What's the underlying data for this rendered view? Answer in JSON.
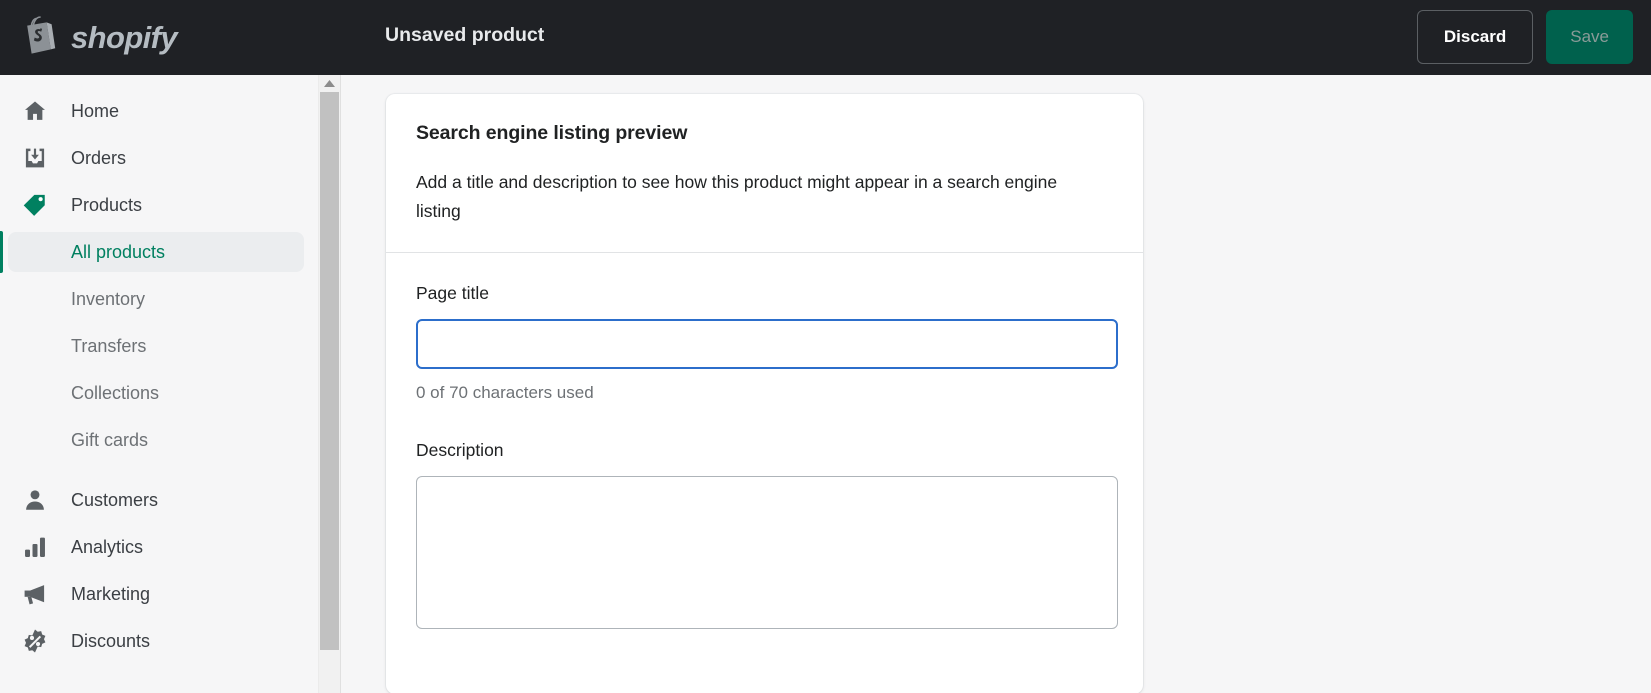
{
  "topbar": {
    "logo_icon": "shopify-bag-icon",
    "logo_word": "shopify",
    "title": "Unsaved product",
    "discard_label": "Discard",
    "save_label": "Save",
    "background": "#1f2125",
    "save_background": "#00614d"
  },
  "sidebar": {
    "items": [
      {
        "label": "Home",
        "icon": "home-icon",
        "type": "nav"
      },
      {
        "label": "Orders",
        "icon": "inbox-download-icon",
        "type": "nav"
      },
      {
        "label": "Products",
        "icon": "tag-icon",
        "type": "nav",
        "icon_color": "#008060"
      },
      {
        "label": "All products",
        "icon": "",
        "type": "sub",
        "active": true
      },
      {
        "label": "Inventory",
        "icon": "",
        "type": "sub"
      },
      {
        "label": "Transfers",
        "icon": "",
        "type": "sub"
      },
      {
        "label": "Collections",
        "icon": "",
        "type": "sub"
      },
      {
        "label": "Gift cards",
        "icon": "",
        "type": "sub"
      },
      {
        "label": "Customers",
        "icon": "person-icon",
        "type": "nav"
      },
      {
        "label": "Analytics",
        "icon": "bar-chart-icon",
        "type": "nav"
      },
      {
        "label": "Marketing",
        "icon": "megaphone-icon",
        "type": "nav"
      },
      {
        "label": "Discounts",
        "icon": "percent-badge-icon",
        "type": "nav"
      }
    ],
    "active_color": "#008060",
    "scrollbar": {
      "up_arrow_icon": "caret-up-icon"
    }
  },
  "main": {
    "card": {
      "title": "Search engine listing preview",
      "subtitle": "Add a title and description to see how this product might appear in a search engine listing",
      "page_title": {
        "label": "Page title",
        "value": "",
        "placeholder": "",
        "help": "0 of 70 characters used",
        "focused": true,
        "focus_color": "#2c6ecb"
      },
      "description": {
        "label": "Description",
        "value": "",
        "placeholder": ""
      }
    }
  }
}
